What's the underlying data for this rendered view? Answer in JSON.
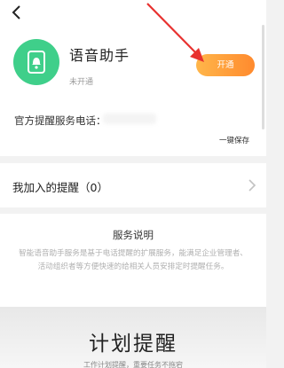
{
  "header": {
    "back_icon": "back-chevron-icon"
  },
  "app": {
    "icon": "phone-bell-icon",
    "icon_color": "#3fcf8a",
    "title": "语音助手",
    "status": "未开通",
    "enable_label": "开通",
    "accent": "#ff9a3c"
  },
  "service_phone": {
    "label": "官方提醒服务电话：",
    "save_label": "一键保存"
  },
  "joined": {
    "label": "我加入的提醒（0）",
    "chevron_icon": "chevron-right-icon"
  },
  "description": {
    "title": "服务说明",
    "body": "智能语音助手服务是基于电话提醒的扩展服务，能满足企业管理者、活动组织者等方便快速的给相关人员安排定时提醒任务。"
  },
  "plan": {
    "title": "计划提醒",
    "subtitle": "工作计划提醒，重要任务不拖宕"
  }
}
